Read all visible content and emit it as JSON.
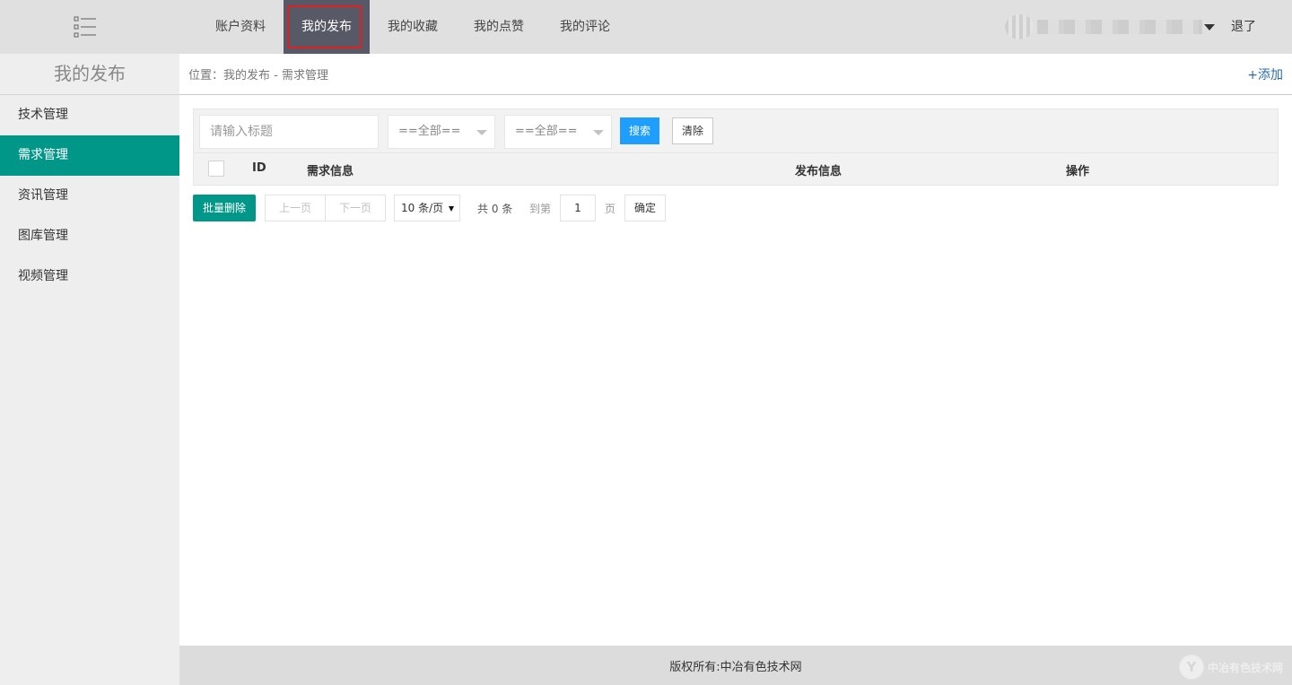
{
  "header": {
    "nav": [
      {
        "label": "账户资料",
        "active": false
      },
      {
        "label": "我的发布",
        "active": true
      },
      {
        "label": "我的收藏",
        "active": false
      },
      {
        "label": "我的点赞",
        "active": false
      },
      {
        "label": "我的评论",
        "active": false
      }
    ],
    "logout": "退了"
  },
  "sidebar": {
    "title": "我的发布",
    "items": [
      {
        "label": "技术管理",
        "active": false
      },
      {
        "label": "需求管理",
        "active": true
      },
      {
        "label": "资讯管理",
        "active": false
      },
      {
        "label": "图库管理",
        "active": false
      },
      {
        "label": "视频管理",
        "active": false
      }
    ]
  },
  "breadcrumb": {
    "text": "位置：我的发布 - 需求管理",
    "add": "+添加"
  },
  "filters": {
    "title_placeholder": "请输入标题",
    "select1": "==全部==",
    "select2": "==全部==",
    "search": "搜索",
    "clear": "清除"
  },
  "table": {
    "columns": [
      "ID",
      "需求信息",
      "发布信息",
      "操作"
    ],
    "rows": []
  },
  "pager": {
    "batch_delete": "批量删除",
    "prev": "上一页",
    "next": "下一页",
    "page_size": "10 条/页",
    "total": "共 0 条",
    "goto": "到第",
    "page_value": "1",
    "page_unit": "页",
    "confirm": "确定"
  },
  "footer": {
    "copyright": "版权所有:中冶有色技术网",
    "watermark": "中冶有色技术网"
  },
  "colors": {
    "accent": "#009688",
    "active_nav": "#575a66",
    "search_button": "#1e9fff",
    "highlight_box": "#e02020"
  }
}
